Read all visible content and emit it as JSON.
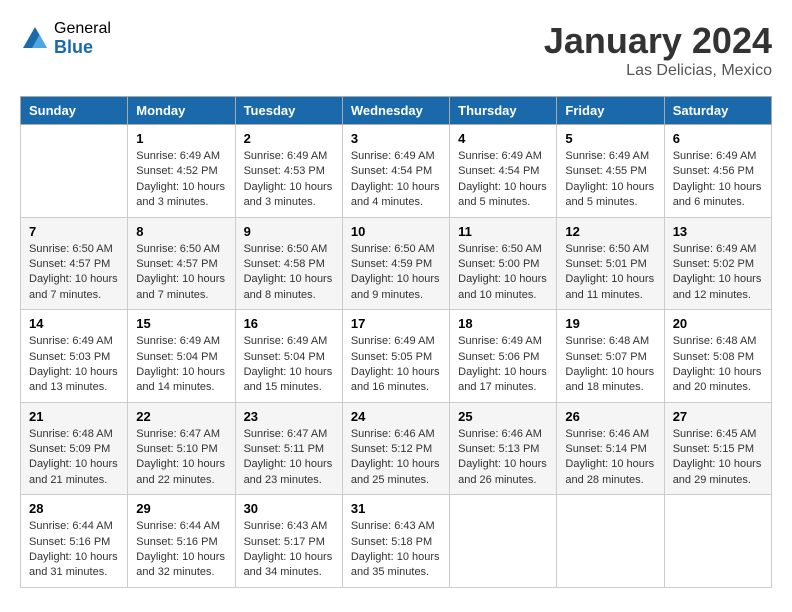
{
  "logo": {
    "general": "General",
    "blue": "Blue"
  },
  "title": "January 2024",
  "subtitle": "Las Delicias, Mexico",
  "days_header": [
    "Sunday",
    "Monday",
    "Tuesday",
    "Wednesday",
    "Thursday",
    "Friday",
    "Saturday"
  ],
  "weeks": [
    [
      {
        "num": "",
        "info": ""
      },
      {
        "num": "1",
        "info": "Sunrise: 6:49 AM\nSunset: 4:52 PM\nDaylight: 10 hours\nand 3 minutes."
      },
      {
        "num": "2",
        "info": "Sunrise: 6:49 AM\nSunset: 4:53 PM\nDaylight: 10 hours\nand 3 minutes."
      },
      {
        "num": "3",
        "info": "Sunrise: 6:49 AM\nSunset: 4:54 PM\nDaylight: 10 hours\nand 4 minutes."
      },
      {
        "num": "4",
        "info": "Sunrise: 6:49 AM\nSunset: 4:54 PM\nDaylight: 10 hours\nand 5 minutes."
      },
      {
        "num": "5",
        "info": "Sunrise: 6:49 AM\nSunset: 4:55 PM\nDaylight: 10 hours\nand 5 minutes."
      },
      {
        "num": "6",
        "info": "Sunrise: 6:49 AM\nSunset: 4:56 PM\nDaylight: 10 hours\nand 6 minutes."
      }
    ],
    [
      {
        "num": "7",
        "info": "Sunrise: 6:50 AM\nSunset: 4:57 PM\nDaylight: 10 hours\nand 7 minutes."
      },
      {
        "num": "8",
        "info": "Sunrise: 6:50 AM\nSunset: 4:57 PM\nDaylight: 10 hours\nand 7 minutes."
      },
      {
        "num": "9",
        "info": "Sunrise: 6:50 AM\nSunset: 4:58 PM\nDaylight: 10 hours\nand 8 minutes."
      },
      {
        "num": "10",
        "info": "Sunrise: 6:50 AM\nSunset: 4:59 PM\nDaylight: 10 hours\nand 9 minutes."
      },
      {
        "num": "11",
        "info": "Sunrise: 6:50 AM\nSunset: 5:00 PM\nDaylight: 10 hours\nand 10 minutes."
      },
      {
        "num": "12",
        "info": "Sunrise: 6:50 AM\nSunset: 5:01 PM\nDaylight: 10 hours\nand 11 minutes."
      },
      {
        "num": "13",
        "info": "Sunrise: 6:49 AM\nSunset: 5:02 PM\nDaylight: 10 hours\nand 12 minutes."
      }
    ],
    [
      {
        "num": "14",
        "info": "Sunrise: 6:49 AM\nSunset: 5:03 PM\nDaylight: 10 hours\nand 13 minutes."
      },
      {
        "num": "15",
        "info": "Sunrise: 6:49 AM\nSunset: 5:04 PM\nDaylight: 10 hours\nand 14 minutes."
      },
      {
        "num": "16",
        "info": "Sunrise: 6:49 AM\nSunset: 5:04 PM\nDaylight: 10 hours\nand 15 minutes."
      },
      {
        "num": "17",
        "info": "Sunrise: 6:49 AM\nSunset: 5:05 PM\nDaylight: 10 hours\nand 16 minutes."
      },
      {
        "num": "18",
        "info": "Sunrise: 6:49 AM\nSunset: 5:06 PM\nDaylight: 10 hours\nand 17 minutes."
      },
      {
        "num": "19",
        "info": "Sunrise: 6:48 AM\nSunset: 5:07 PM\nDaylight: 10 hours\nand 18 minutes."
      },
      {
        "num": "20",
        "info": "Sunrise: 6:48 AM\nSunset: 5:08 PM\nDaylight: 10 hours\nand 20 minutes."
      }
    ],
    [
      {
        "num": "21",
        "info": "Sunrise: 6:48 AM\nSunset: 5:09 PM\nDaylight: 10 hours\nand 21 minutes."
      },
      {
        "num": "22",
        "info": "Sunrise: 6:47 AM\nSunset: 5:10 PM\nDaylight: 10 hours\nand 22 minutes."
      },
      {
        "num": "23",
        "info": "Sunrise: 6:47 AM\nSunset: 5:11 PM\nDaylight: 10 hours\nand 23 minutes."
      },
      {
        "num": "24",
        "info": "Sunrise: 6:46 AM\nSunset: 5:12 PM\nDaylight: 10 hours\nand 25 minutes."
      },
      {
        "num": "25",
        "info": "Sunrise: 6:46 AM\nSunset: 5:13 PM\nDaylight: 10 hours\nand 26 minutes."
      },
      {
        "num": "26",
        "info": "Sunrise: 6:46 AM\nSunset: 5:14 PM\nDaylight: 10 hours\nand 28 minutes."
      },
      {
        "num": "27",
        "info": "Sunrise: 6:45 AM\nSunset: 5:15 PM\nDaylight: 10 hours\nand 29 minutes."
      }
    ],
    [
      {
        "num": "28",
        "info": "Sunrise: 6:44 AM\nSunset: 5:16 PM\nDaylight: 10 hours\nand 31 minutes."
      },
      {
        "num": "29",
        "info": "Sunrise: 6:44 AM\nSunset: 5:16 PM\nDaylight: 10 hours\nand 32 minutes."
      },
      {
        "num": "30",
        "info": "Sunrise: 6:43 AM\nSunset: 5:17 PM\nDaylight: 10 hours\nand 34 minutes."
      },
      {
        "num": "31",
        "info": "Sunrise: 6:43 AM\nSunset: 5:18 PM\nDaylight: 10 hours\nand 35 minutes."
      },
      {
        "num": "",
        "info": ""
      },
      {
        "num": "",
        "info": ""
      },
      {
        "num": "",
        "info": ""
      }
    ]
  ]
}
